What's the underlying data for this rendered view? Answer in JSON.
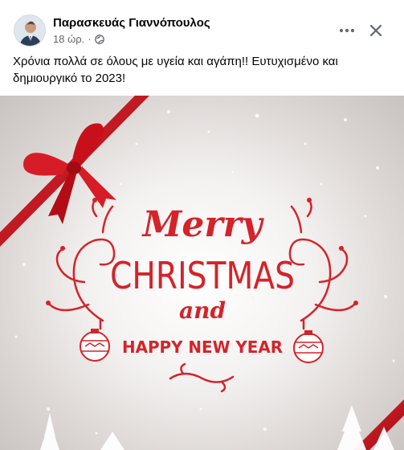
{
  "post": {
    "author": "Παρασκευάς Γιαννόπουλος",
    "time": "18 ώρ.",
    "privacy_icon": "globe-icon",
    "text": "Χρόνια πολλά σε όλους με υγεία και αγάπη!! Ευτυχισμένο και δημιουργικό το 2023!"
  },
  "header_actions": {
    "more_icon": "more-options-icon",
    "close_icon": "close-icon"
  },
  "image": {
    "line1": "Merry",
    "line2": "CHRISTMAS",
    "line3": "and",
    "line4": "HAPPY NEW YEAR",
    "accent_color": "#d4232a",
    "ribbon_color": "#c8101a"
  }
}
